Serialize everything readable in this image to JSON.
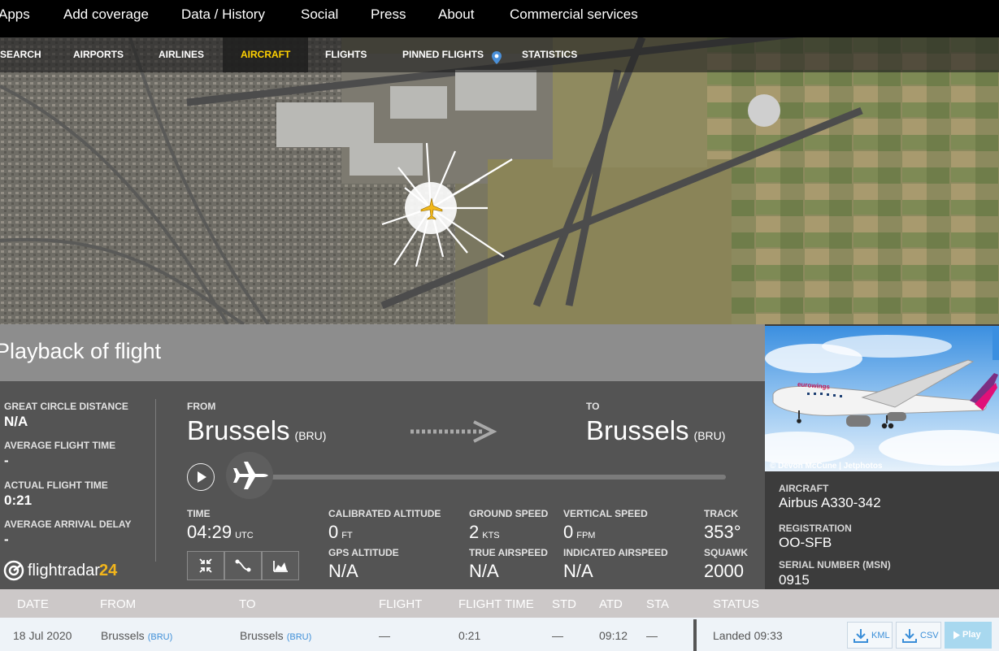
{
  "top_nav": [
    "Apps",
    "Add coverage",
    "Data / History",
    "Social",
    "Press",
    "About",
    "Commercial services"
  ],
  "sub_nav": {
    "items": [
      "SEARCH",
      "AIRPORTS",
      "AIRLINES",
      "AIRCRAFT",
      "FLIGHTS",
      "PINNED FLIGHTS",
      "STATISTICS"
    ],
    "active": "AIRCRAFT",
    "active_color": "#ffd100"
  },
  "playback": {
    "title": "Playback of flight",
    "stats": [
      {
        "label": "GREAT CIRCLE DISTANCE",
        "value": "N/A"
      },
      {
        "label": "AVERAGE FLIGHT TIME",
        "value": "-"
      },
      {
        "label": "ACTUAL FLIGHT TIME",
        "value": "0:21"
      },
      {
        "label": "AVERAGE ARRIVAL DELAY",
        "value": "-"
      }
    ],
    "from": {
      "label": "FROM",
      "city": "Brussels",
      "code": "(BRU)"
    },
    "to": {
      "label": "TO",
      "city": "Brussels",
      "code": "(BRU)"
    },
    "time": {
      "label": "TIME",
      "value": "04:29",
      "unit": "UTC"
    },
    "calibrated_altitude": {
      "label": "CALIBRATED ALTITUDE",
      "value": "0",
      "unit": "FT"
    },
    "gps_altitude": {
      "label": "GPS ALTITUDE",
      "value": "N/A"
    },
    "ground_speed": {
      "label": "GROUND SPEED",
      "value": "2",
      "unit": "KTS"
    },
    "true_airspeed": {
      "label": "TRUE AIRSPEED",
      "value": "N/A"
    },
    "vertical_speed": {
      "label": "VERTICAL SPEED",
      "value": "0",
      "unit": "FPM"
    },
    "indicated_airspeed": {
      "label": "INDICATED AIRSPEED",
      "value": "N/A"
    },
    "track": {
      "label": "TRACK",
      "value": "353°"
    },
    "squawk": {
      "label": "SQUAWK",
      "value": "2000"
    },
    "logo": {
      "main": "flightradar",
      "suffix": "24"
    }
  },
  "aircraft_info": {
    "photo_credit": "© Devon McCune | Jetphotos",
    "livery_text": "eurowings",
    "aircraft": {
      "label": "AIRCRAFT",
      "value": "Airbus A330-342"
    },
    "registration": {
      "label": "REGISTRATION",
      "value": "OO-SFB"
    },
    "serial": {
      "label": "SERIAL NUMBER (MSN)",
      "value": "0915"
    }
  },
  "table": {
    "headers": [
      "DATE",
      "FROM",
      "TO",
      "FLIGHT",
      "FLIGHT TIME",
      "STD",
      "ATD",
      "STA",
      "STATUS"
    ],
    "row": {
      "date": "18 Jul 2020",
      "from_city": "Brussels",
      "from_code": "(BRU)",
      "to_city": "Brussels",
      "to_code": "(BRU)",
      "flight": "—",
      "flight_time": "0:21",
      "std": "—",
      "atd": "09:12",
      "sta": "—",
      "status": "Landed 09:33"
    },
    "buttons": {
      "kml": "KML",
      "csv": "CSV",
      "play": "Play"
    }
  }
}
